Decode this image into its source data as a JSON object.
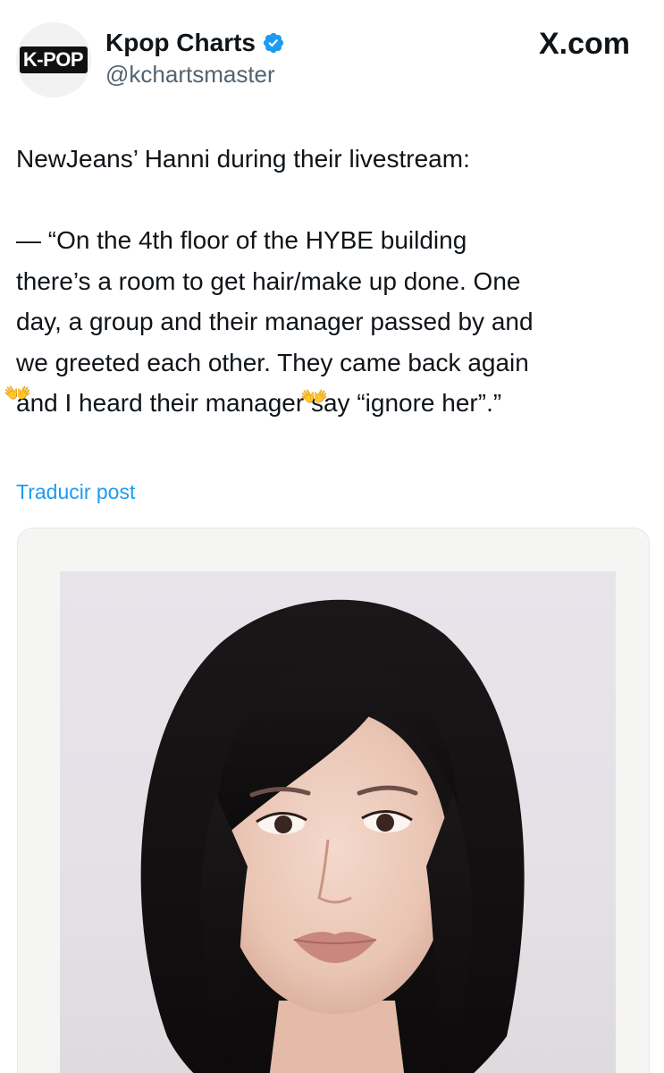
{
  "header": {
    "avatar_logo_text": "K-POP",
    "display_name": "Kpop Charts",
    "handle": "@kchartsmaster",
    "site_label": "X.com",
    "verified_icon": "verified-badge-icon",
    "verified_color": "#1d9bf0"
  },
  "tweet": {
    "lines": [
      "NewJeans’ Hanni during their livestream:",
      "",
      "— “On the 4th floor of the HYBE building",
      "there’s a room to get hair/make up done. One",
      "day, a group and their manager passed by and",
      "we greeted each other. They came back again",
      "and I heard their manager say “ignore her”.”"
    ],
    "emoji": "👐",
    "translate_label": "Traducir post"
  },
  "media": {
    "type": "photo",
    "subject": "portrait-photo"
  },
  "colors": {
    "text": "#0f1419",
    "secondary": "#536471",
    "link": "#1d9bf0",
    "background": "#ffffff"
  }
}
